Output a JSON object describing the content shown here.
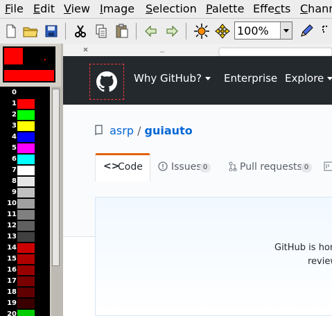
{
  "menu": [
    "File",
    "Edit",
    "View",
    "Image",
    "Selection",
    "Palette",
    "Effects",
    "Chann"
  ],
  "menu_underline": [
    "F",
    "E",
    "V",
    "I",
    "S",
    "P",
    "c",
    "C"
  ],
  "toolbar": {
    "zoom_value": "100%"
  },
  "palette": {
    "numbers": [
      "0",
      "1",
      "2",
      "3",
      "4",
      "5",
      "6",
      "7",
      "8",
      "9",
      "10",
      "11",
      "12",
      "13",
      "14",
      "15",
      "16",
      "17",
      "18",
      "19",
      "20"
    ],
    "colors": [
      "#000000",
      "#ff0000",
      "#00ff00",
      "#ffff00",
      "#0000ff",
      "#ff00ff",
      "#00ffff",
      "#ffffff",
      "#e6e6e6",
      "#c0c0c0",
      "#a0a0a0",
      "#808080",
      "#606060",
      "#404040",
      "#cc0000",
      "#b00000",
      "#990000",
      "#7a0000",
      "#600000",
      "#3a0000",
      "#00cc00"
    ]
  },
  "github": {
    "nav": [
      "Why GitHub?",
      "Enterprise",
      "Explore"
    ],
    "repo_owner": "asrp",
    "repo_sep": "/",
    "repo_name": "guiauto",
    "tabs": [
      {
        "label": "Code",
        "count": ""
      },
      {
        "label": "Issues",
        "count": "0"
      },
      {
        "label": "Pull requests",
        "count": "0"
      }
    ],
    "banner_line1": "GitHub is hom",
    "banner_line2": "review"
  },
  "colors": {
    "gh_header": "#24292e",
    "link": "#0366d6",
    "tab_accent": "#e36209"
  }
}
